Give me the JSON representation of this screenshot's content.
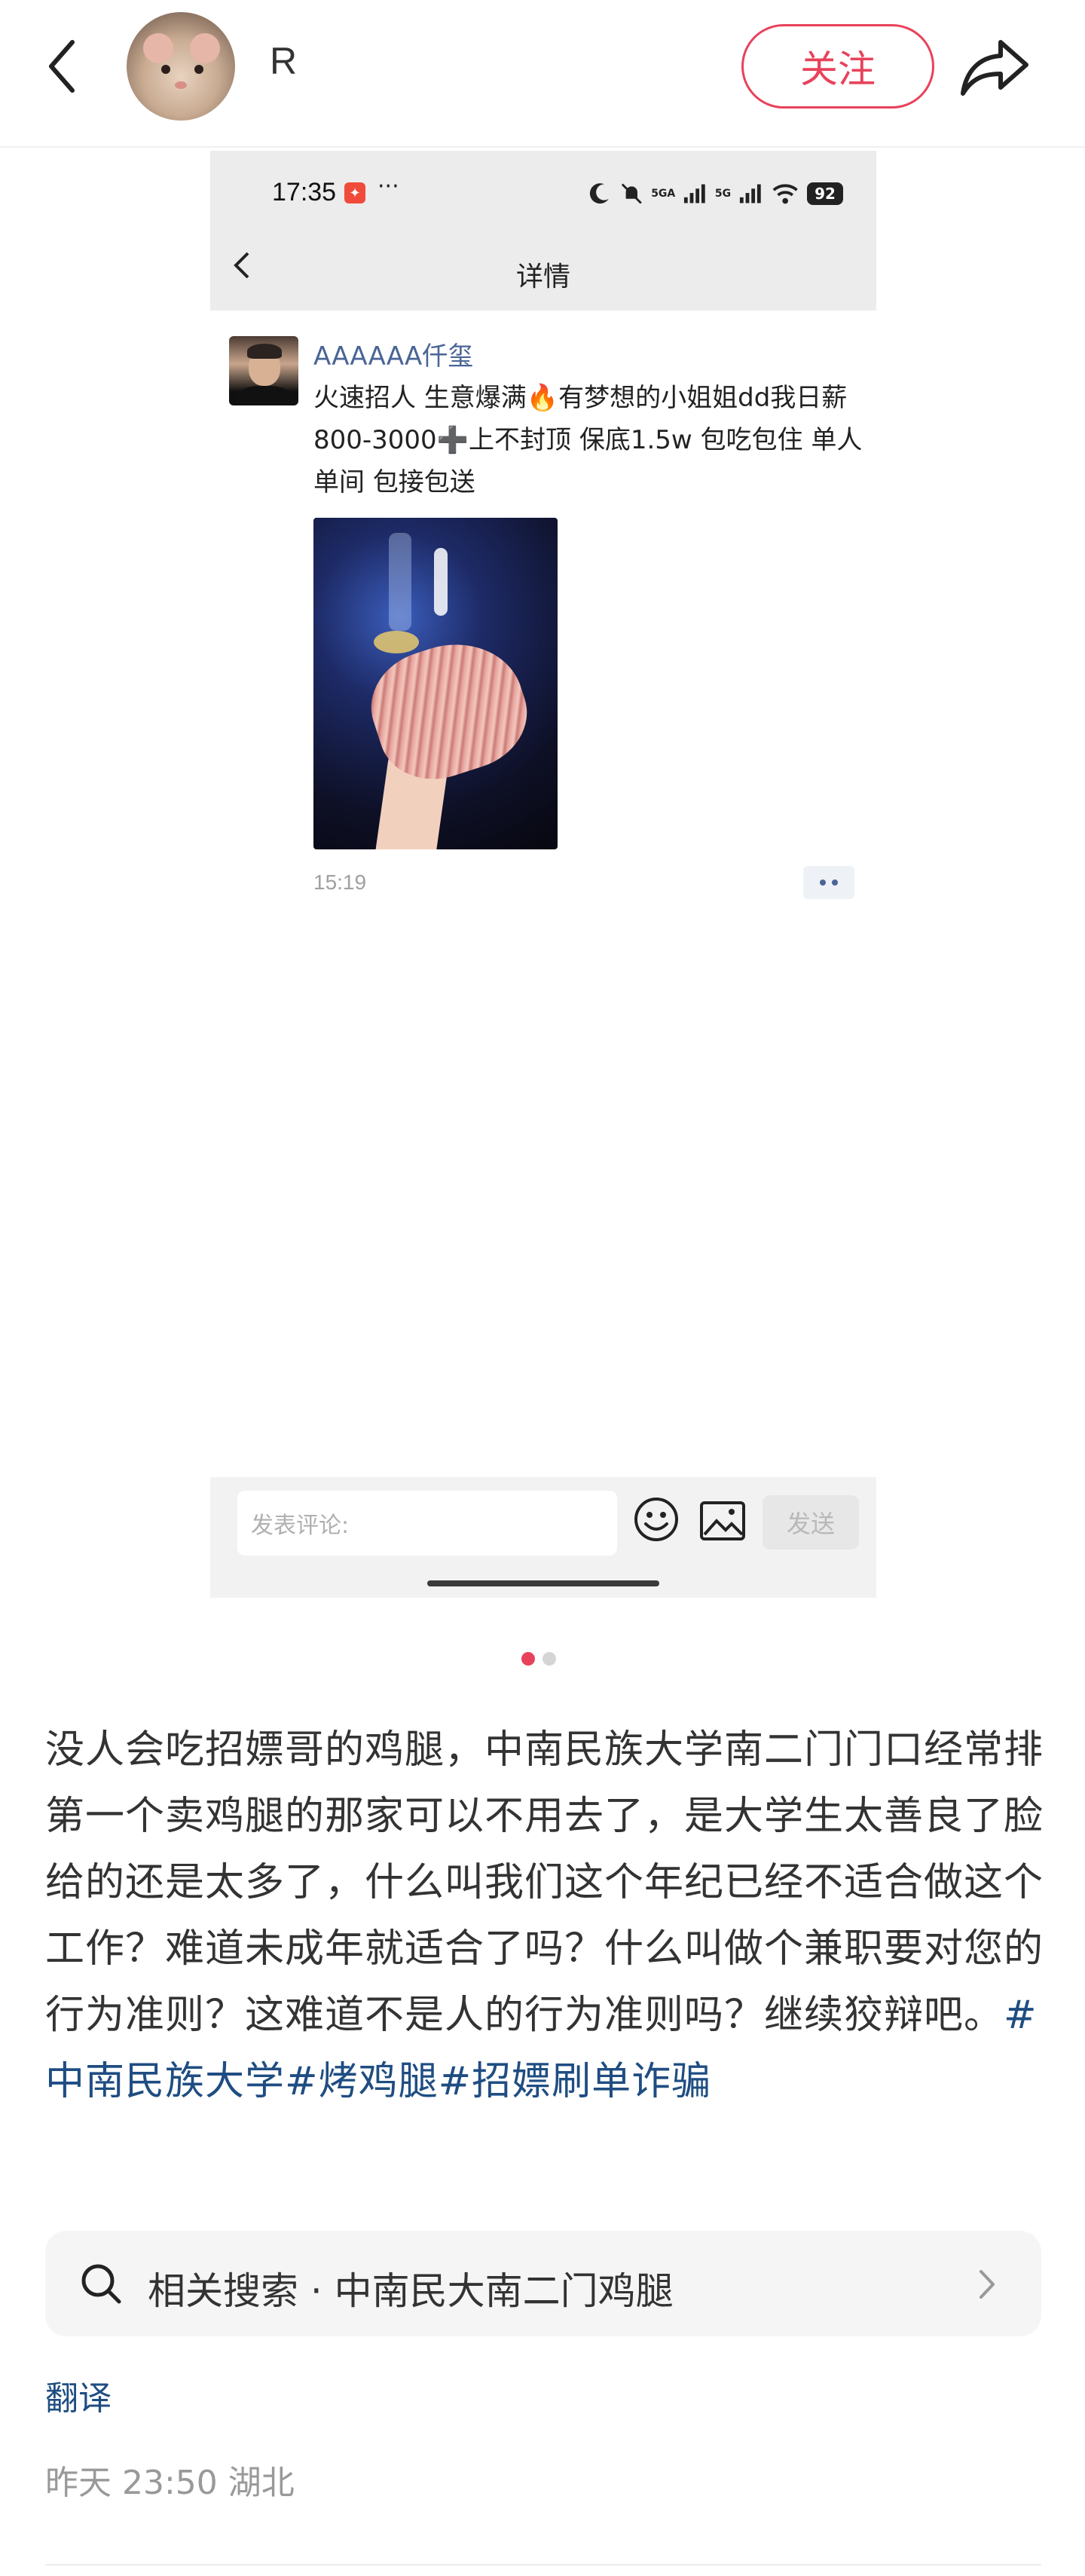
{
  "header": {
    "username": "R",
    "follow_label": "关注"
  },
  "embedded_screenshot": {
    "status_time": "17:35",
    "status_dots": "···",
    "battery": "92",
    "signal_labels": [
      "5GA",
      "5G"
    ],
    "page_title": "详情",
    "post": {
      "author": "AAAAAA仟玺",
      "text": "火速招人 生意爆满🔥有梦想的小姐姐dd我日薪800-3000➕上不封顶 保底1.5w 包吃包住 单人单间 包接包送",
      "time": "15:19"
    },
    "comment_bar": {
      "placeholder": "发表评论:",
      "send_label": "发送"
    }
  },
  "pager": {
    "count": 2,
    "active": 1
  },
  "caption": {
    "text": "没人会吃招嫖哥的鸡腿，中南民族大学南二门门口经常排第一个卖鸡腿的那家可以不用去了，是大学生太善良了脸给的还是太多了，什么叫我们这个年纪已经不适合做这个工作？难道未成年就适合了吗？什么叫做个兼职要对您的行为准则？这难道不是人的行为准则吗？继续狡辩吧。",
    "tags": [
      "#中南民族大学",
      "#烤鸡腿",
      "#招嫖刷单诈骗"
    ]
  },
  "related_search": {
    "label": "相关搜索 · 中南民大南二门鸡腿"
  },
  "translate_label": "翻译",
  "meta": "昨天 23:50 湖北",
  "colors": {
    "accent": "#e8425b",
    "link": "#1f4d82",
    "author": "#4a6596"
  }
}
